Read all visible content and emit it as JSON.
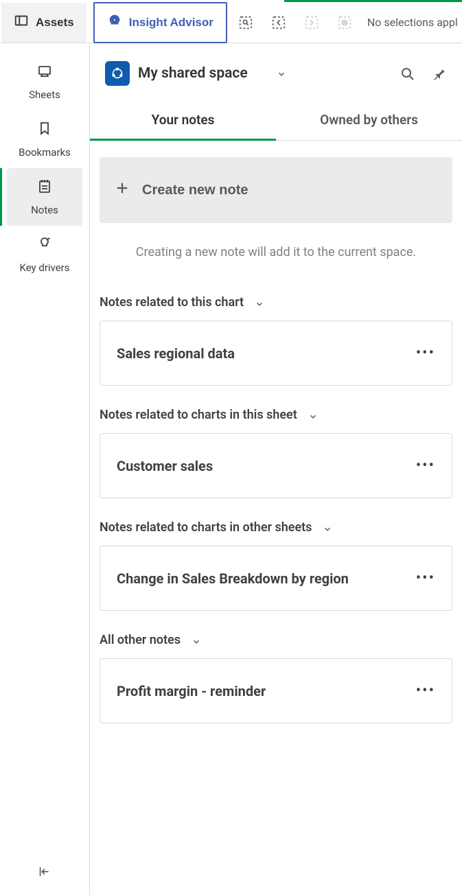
{
  "toolbar": {
    "assets_label": "Assets",
    "insight_label": "Insight Advisor",
    "selections_text": "No selections appl"
  },
  "sidebar": {
    "items": [
      {
        "label": "Sheets"
      },
      {
        "label": "Bookmarks"
      },
      {
        "label": "Notes"
      },
      {
        "label": "Key drivers"
      }
    ]
  },
  "panel": {
    "space_title": "My shared space",
    "tabs": {
      "your_notes": "Your notes",
      "owned_by_others": "Owned by others"
    },
    "create_label": "Create new note",
    "hint": "Creating a new note will add it to the current space.",
    "sections": [
      {
        "title": "Notes related to this chart",
        "notes": [
          {
            "title": "Sales regional data"
          }
        ]
      },
      {
        "title": "Notes related to charts in this sheet",
        "notes": [
          {
            "title": "Customer sales"
          }
        ]
      },
      {
        "title": "Notes related to charts in other sheets",
        "notes": [
          {
            "title": "Change in Sales Breakdown by region"
          }
        ]
      },
      {
        "title": "All other notes",
        "notes": [
          {
            "title": "Profit margin - reminder"
          }
        ]
      }
    ]
  }
}
